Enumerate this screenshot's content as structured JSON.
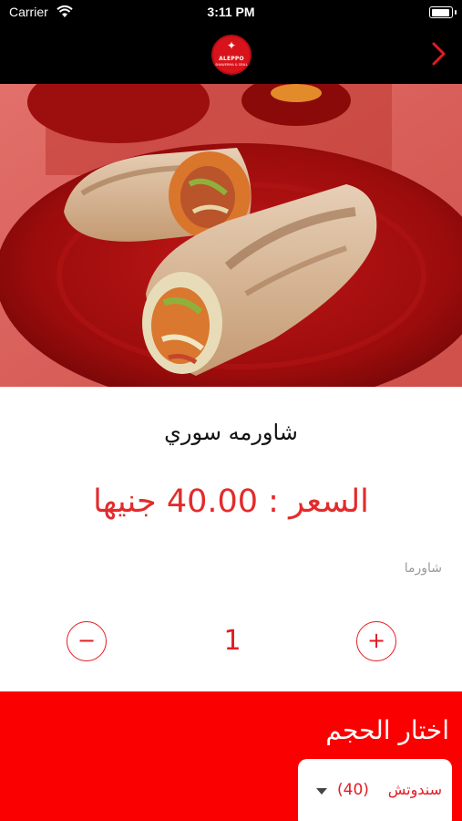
{
  "status_bar": {
    "carrier": "Carrier",
    "time": "3:11 PM",
    "wifi_icon": "wifi-icon",
    "battery_icon": "battery-icon"
  },
  "nav": {
    "logo_text": "ALEPPO",
    "logo_subtext": "SHAWERMA & GRILL",
    "forward_icon": "chevron-right-icon",
    "accent_color": "#e31b23"
  },
  "product": {
    "name": "شاورمه سوري",
    "price_label": "السعر :",
    "price_value": "40.00",
    "currency": "جنيها",
    "category": "شاورما",
    "image_subject": "shawarma wrap on red plate"
  },
  "quantity": {
    "minus_label": "−",
    "plus_label": "+",
    "value": "1"
  },
  "size": {
    "title": "اختار الحجم",
    "selected_label": "سندوتش",
    "selected_price": "(40)",
    "dropdown_icon": "caret-down-icon",
    "panel_color": "#fb0000"
  }
}
